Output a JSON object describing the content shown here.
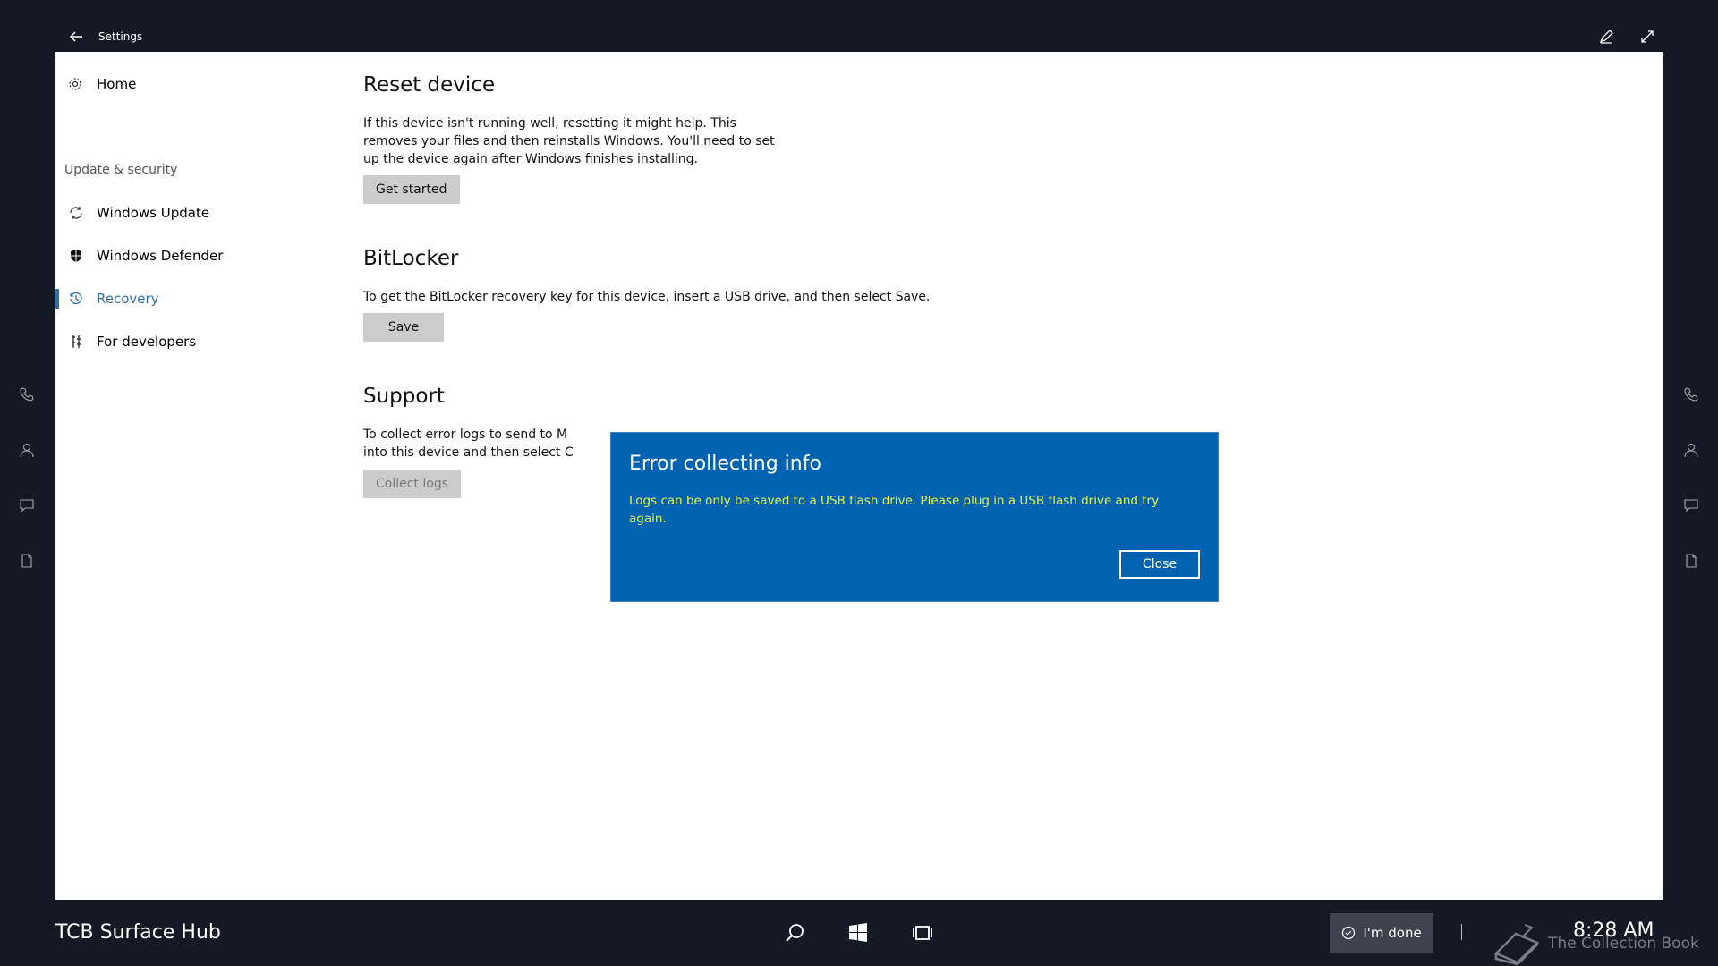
{
  "window": {
    "title": "Settings"
  },
  "nav": {
    "home_label": "Home",
    "section_label": "Update & security",
    "items": [
      {
        "label": "Windows Update",
        "icon": "refresh-icon"
      },
      {
        "label": "Windows Defender",
        "icon": "shield-icon"
      },
      {
        "label": "Recovery",
        "icon": "history-icon",
        "active": true
      },
      {
        "label": "For developers",
        "icon": "tools-icon"
      }
    ]
  },
  "reset": {
    "title": "Reset device",
    "description": "If this device isn't running well, resetting it might help. This removes your files and then reinstalls Windows. You'll need to set up the device again after Windows finishes installing.",
    "button": "Get started"
  },
  "bitlocker": {
    "title": "BitLocker",
    "description": "To get the BitLocker recovery key for this device, insert a USB drive, and then select Save.",
    "button": "Save"
  },
  "support": {
    "title": "Support",
    "line1": "To collect error logs to send to M",
    "line2": "into this device and then select C",
    "button": "Collect logs"
  },
  "dialog": {
    "title": "Error collecting info",
    "message": "Logs can be only be saved to a USB flash drive. Please plug in a USB flash drive and try again.",
    "close_label": "Close"
  },
  "taskbar": {
    "device_name": "TCB Surface Hub",
    "done_label": "I'm done",
    "time": "8:28 AM"
  },
  "watermark": {
    "text": "The Collection Book"
  },
  "colors": {
    "accent": "#2f6fa8",
    "dialog_bg": "#0063b1",
    "dialog_text": "#e8f24a",
    "background": "#131a26"
  }
}
